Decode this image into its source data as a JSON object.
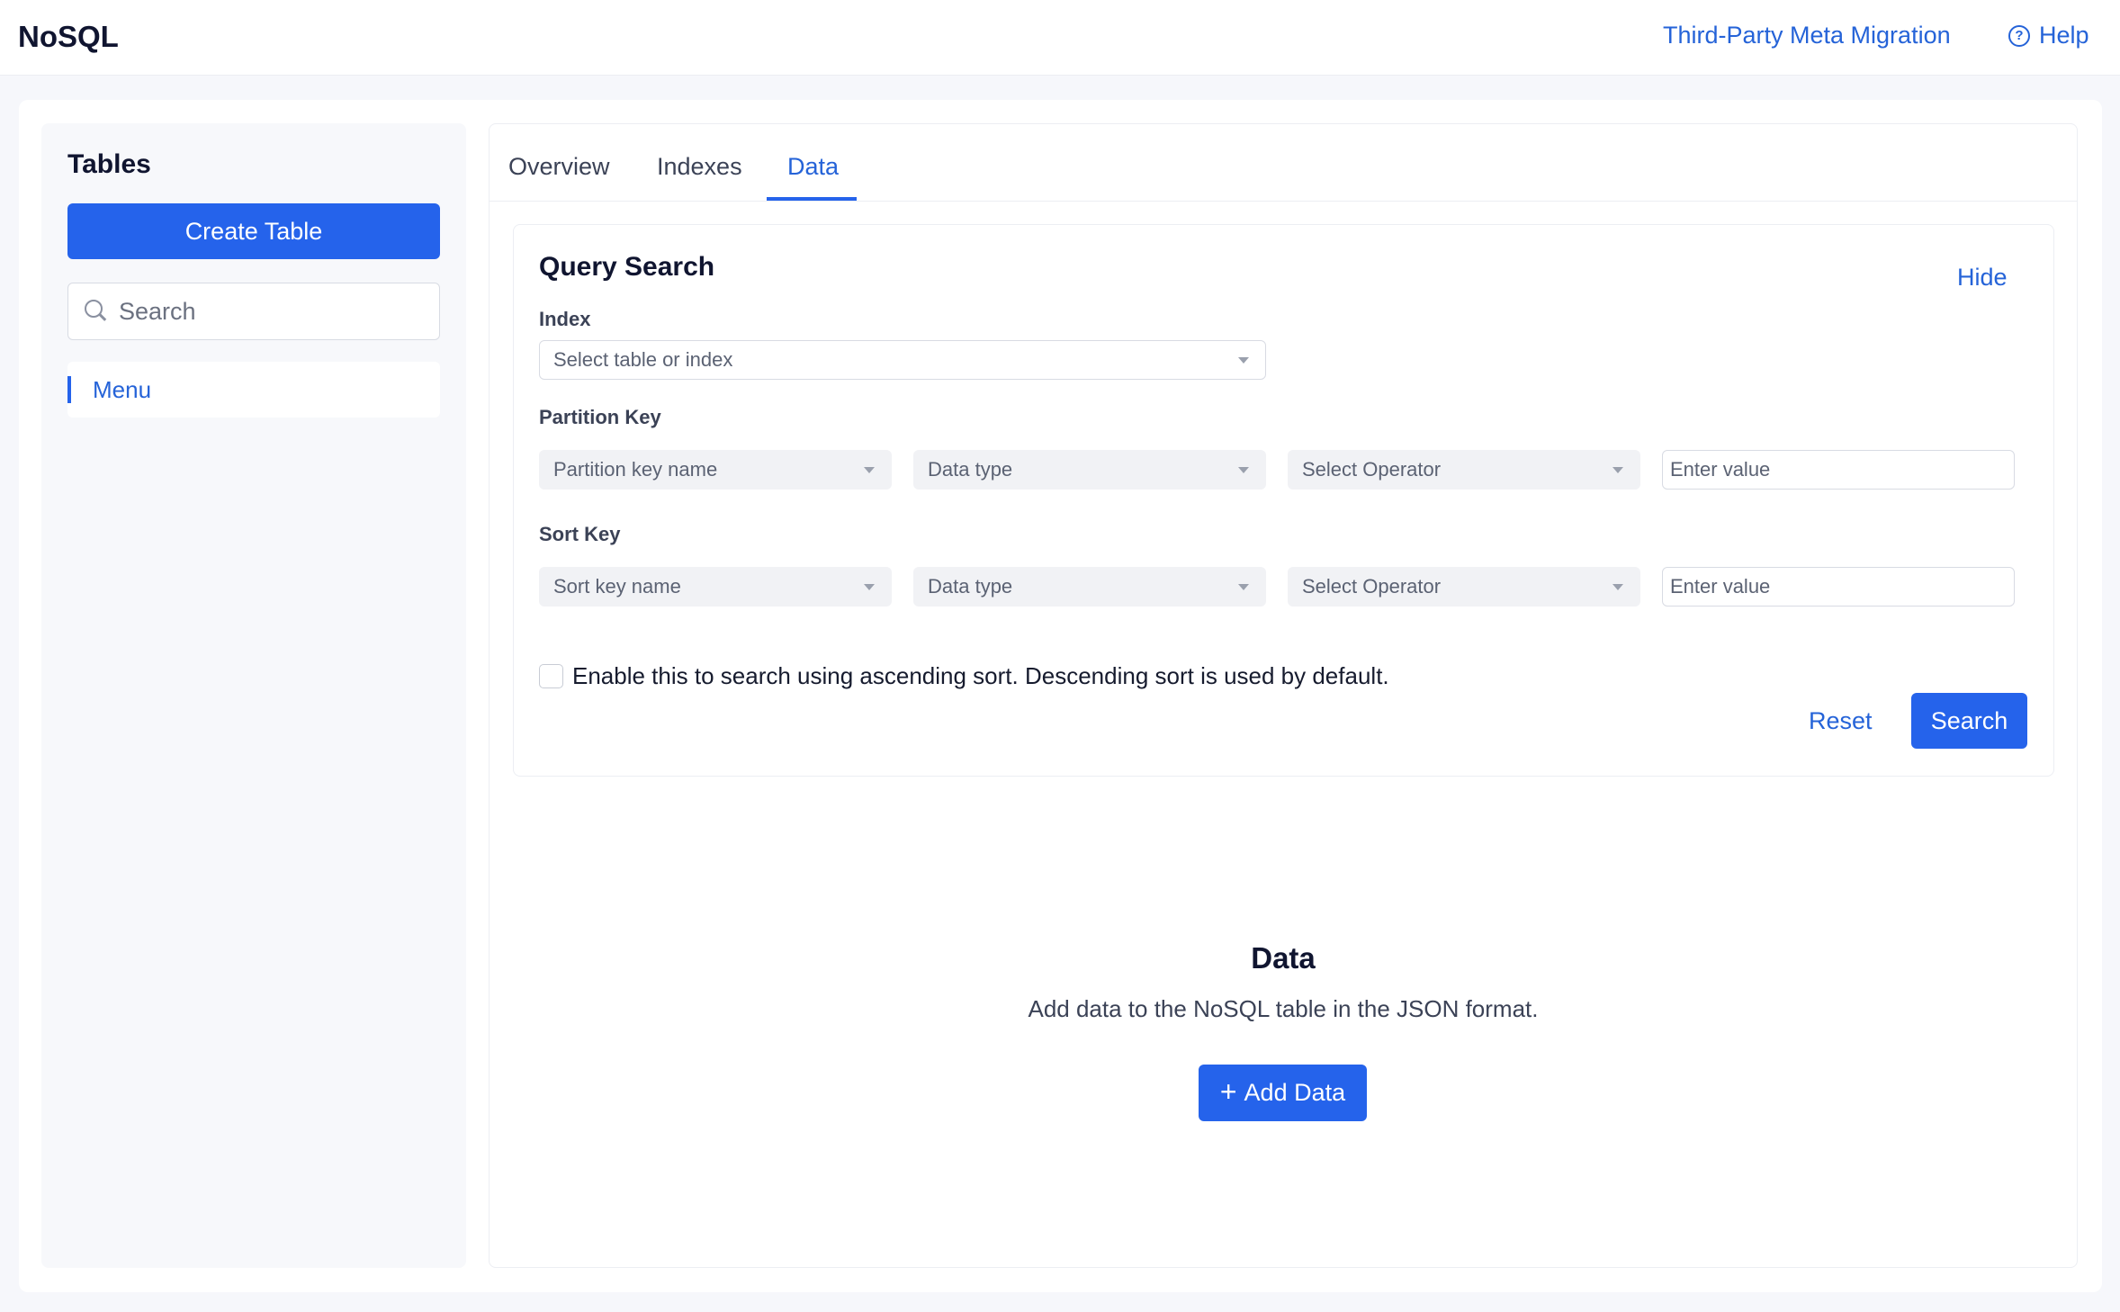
{
  "header": {
    "brand": "NoSQL",
    "migration_link": "Third-Party Meta Migration",
    "help_link": "Help",
    "help_icon": "question-circle-icon"
  },
  "sidebar": {
    "title": "Tables",
    "create_button": "Create Table",
    "search_placeholder": "Search",
    "items": [
      {
        "label": "Menu"
      }
    ]
  },
  "tabs": [
    {
      "label": "Overview"
    },
    {
      "label": "Indexes"
    },
    {
      "label": "Data",
      "active": true
    }
  ],
  "query_search": {
    "title": "Query Search",
    "hide_label": "Hide",
    "index": {
      "label": "Index",
      "placeholder": "Select table or index"
    },
    "partition_key": {
      "label": "Partition Key",
      "name_placeholder": "Partition key name",
      "type_placeholder": "Data type",
      "operator_placeholder": "Select Operator",
      "value_placeholder": "Enter value"
    },
    "sort_key": {
      "label": "Sort Key",
      "name_placeholder": "Sort key name",
      "type_placeholder": "Data type",
      "operator_placeholder": "Select Operator",
      "value_placeholder": "Enter value"
    },
    "ascending_checkbox_label": "Enable this to search using ascending sort. Descending sort is used by default.",
    "ascending_checked": false,
    "reset_label": "Reset",
    "search_label": "Search"
  },
  "empty_state": {
    "title": "Data",
    "description": "Add data to the NoSQL table in the JSON format.",
    "add_button": "Add Data"
  },
  "colors": {
    "accent": "#2563eb",
    "link": "#2563d8",
    "text": "#161b2e",
    "background": "#f6f7fb"
  }
}
